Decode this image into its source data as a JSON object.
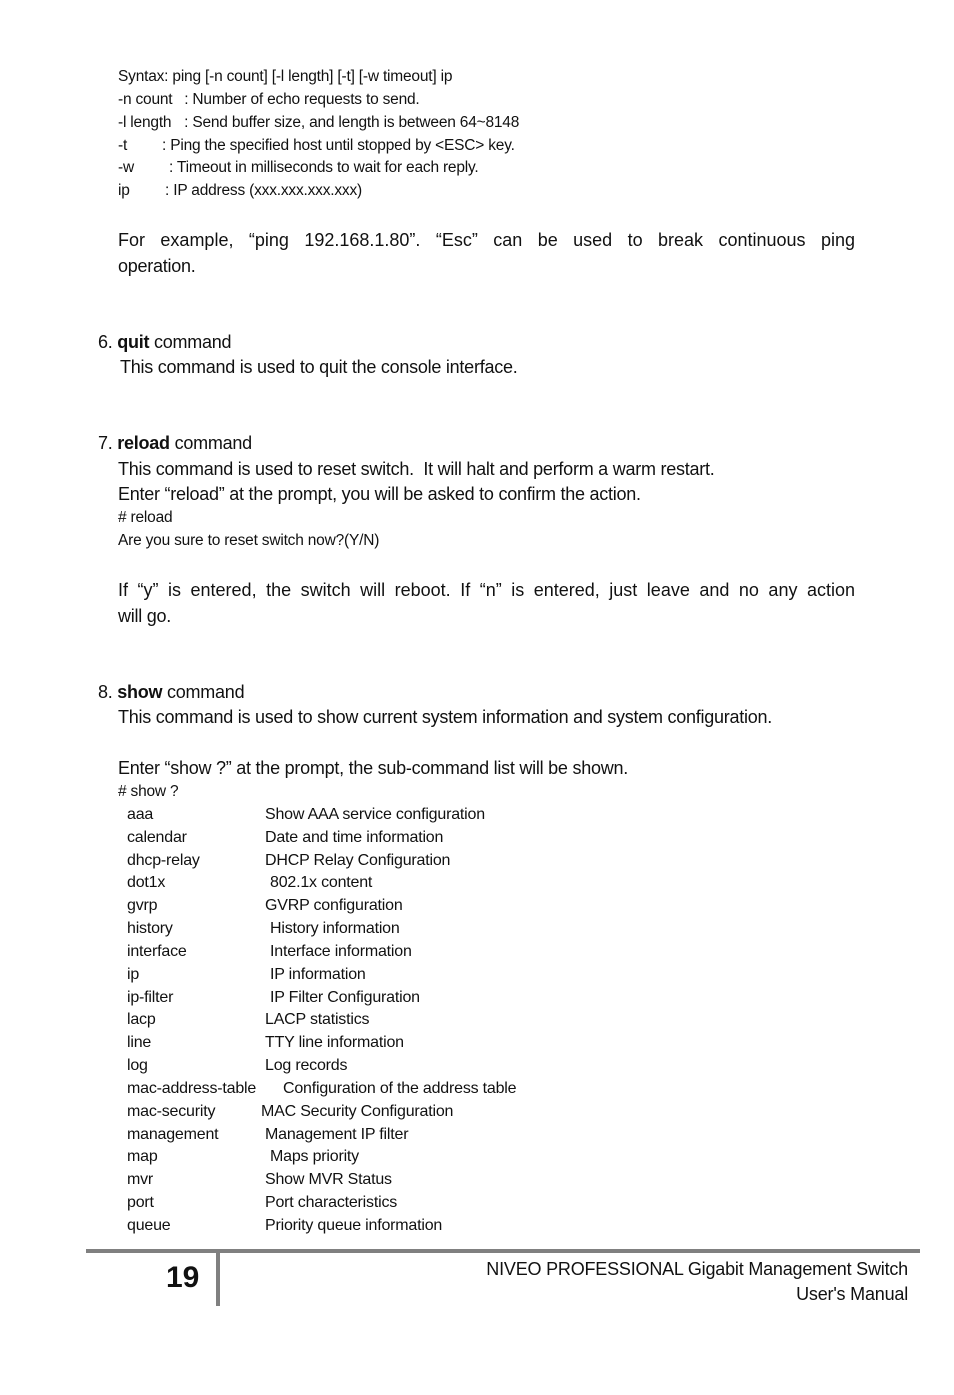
{
  "ping_syntax": {
    "syntax": "Syntax: ping [-n count] [-l length] [-t] [-w timeout] ip",
    "options": [
      {
        "flag": "-n count",
        "desc": "  : Number of echo requests to send."
      },
      {
        "flag": "-l length",
        "desc": " : Send buffer size, and length is between 64~8148"
      },
      {
        "flag": "-t",
        "desc": ": Ping the specified host until stopped by <ESC> key."
      },
      {
        "flag": "-w",
        "desc": ": Timeout in milliseconds to wait for each reply."
      },
      {
        "flag": "ip",
        "desc": ": IP address (xxx.xxx.xxx.xxx)"
      }
    ],
    "example_line1": "For example, “ping 192.168.1.80”.  “Esc” can be used to break continuous ping",
    "example_line2": "operation."
  },
  "sections": {
    "quit": {
      "number": "6.",
      "keyword": "quit",
      "suffix": " command",
      "desc": "This command is used to quit the console interface."
    },
    "reload": {
      "number": "7.",
      "keyword": "reload",
      "suffix": " command",
      "desc1": "This command is used to reset switch.  It will halt and perform a warm restart.",
      "desc2": "Enter “reload” at the prompt, you will be asked to confirm the action.",
      "console1": "# reload",
      "console2": "Are you sure to reset switch now?(Y/N)",
      "note_line1": "If “y” is entered, the switch will reboot.  If “n” is entered, just leave and no any action",
      "note_line2": "will go."
    },
    "show": {
      "number": "8.",
      "keyword": "show",
      "suffix": " command",
      "desc": "This command is used to show current system information and system configuration.",
      "enter": "Enter “show ?” at the prompt, the sub-command list will be shown.",
      "console": "# show ?",
      "subcommands": [
        {
          "cmd": "aaa",
          "desc": "Show AAA service configuration"
        },
        {
          "cmd": "calendar",
          "desc": "Date and time information"
        },
        {
          "cmd": "dhcp-relay",
          "desc": "DHCP Relay Configuration"
        },
        {
          "cmd": "dot1x",
          "desc": "802.1x content"
        },
        {
          "cmd": "gvrp",
          "desc": "GVRP configuration"
        },
        {
          "cmd": "history",
          "desc": "History information"
        },
        {
          "cmd": "interface",
          "desc": "Interface information"
        },
        {
          "cmd": "ip",
          "desc": "IP information"
        },
        {
          "cmd": "ip-filter",
          "desc": "IP Filter Configuration"
        },
        {
          "cmd": "lacp",
          "desc": "LACP statistics"
        },
        {
          "cmd": "line",
          "desc": "TTY line information"
        },
        {
          "cmd": "log",
          "desc": "Log records"
        },
        {
          "cmd": "mac-address-table",
          "desc": "Configuration of the address table"
        },
        {
          "cmd": "mac-security",
          "desc": "MAC Security Configuration"
        },
        {
          "cmd": "management",
          "desc": "Management IP filter"
        },
        {
          "cmd": "map",
          "desc": "Maps priority"
        },
        {
          "cmd": "mvr",
          "desc": "Show MVR Status"
        },
        {
          "cmd": "port",
          "desc": "Port characteristics"
        },
        {
          "cmd": "queue",
          "desc": "Priority queue information"
        }
      ]
    }
  },
  "footer": {
    "page_number": "19",
    "title_line1": "NIVEO PROFESSIONAL Gigabit Management Switch",
    "title_line2": "User's Manual"
  }
}
